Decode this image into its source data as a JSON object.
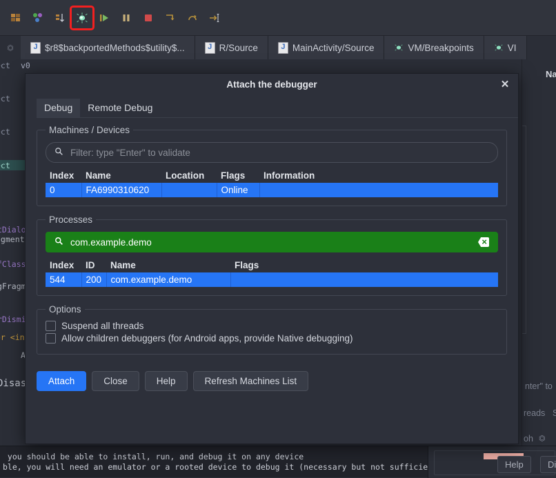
{
  "toolbar": {
    "icons": [
      {
        "name": "modules-icon",
        "highlighted": false
      },
      {
        "name": "processes-icon",
        "highlighted": false
      },
      {
        "name": "call-stack-icon",
        "highlighted": false
      },
      {
        "name": "attach-debugger-icon",
        "highlighted": true
      },
      {
        "name": "resume-icon",
        "highlighted": false
      },
      {
        "name": "pause-icon",
        "highlighted": false
      },
      {
        "name": "stop-icon",
        "highlighted": false
      },
      {
        "name": "step-over-icon",
        "highlighted": false
      },
      {
        "name": "step-out-icon",
        "highlighted": false
      },
      {
        "name": "run-to-cursor-icon",
        "highlighted": false
      }
    ]
  },
  "tabs": [
    {
      "label": "$r8$backportedMethods$utility$...",
      "icon": "java-file-icon",
      "active": true
    },
    {
      "label": "R/Source",
      "icon": "java-file-icon",
      "active": false
    },
    {
      "label": "MainActivity/Source",
      "icon": "java-file-icon",
      "active": false
    },
    {
      "label": "VM/Breakpoints",
      "icon": "bug-icon",
      "active": false
    },
    {
      "label": "VI",
      "icon": "bug-icon",
      "active": false
    }
  ],
  "editor": {
    "gutter_labels": [
      "ect",
      "ect",
      "ect",
      "ect"
    ],
    "top_value": "v0",
    "code_fragments": [
      "tDialog",
      "agment",
      "fClasse",
      "gFragme",
      "rDismis",
      "or <in",
      "A",
      "Disass"
    ]
  },
  "right_panel": {
    "header": "Na",
    "ghost_texts": [
      "nter\" to",
      "reads",
      "S",
      "oh"
    ],
    "ghost_buttons": [
      "lp",
      "Dis"
    ]
  },
  "console": {
    "lines": [
      " you should be able to install, run, and debug it on any device",
      "ble, you will need an emulator or a rooted device to debug it (necessary but not sufficient,"
    ]
  },
  "bottom_right": {
    "help_label": "Help",
    "dis_label": "Dis"
  },
  "dialog": {
    "title": "Attach the debugger",
    "close_icon": "close-icon",
    "tabs": [
      {
        "label": "Debug",
        "active": true
      },
      {
        "label": "Remote Debug",
        "active": false
      }
    ],
    "machines": {
      "legend": "Machines / Devices",
      "filter_placeholder": "Filter: type \"Enter\" to validate",
      "filter_value": "",
      "search_icon": "search-icon",
      "columns": [
        "Index",
        "Name",
        "Location",
        "Flags",
        "Information"
      ],
      "rows": [
        {
          "index": "0",
          "name": "FA6990310620",
          "location": "",
          "flags": "Online",
          "information": ""
        }
      ]
    },
    "processes": {
      "legend": "Processes",
      "filter_placeholder": "",
      "filter_value": "com.example.demo",
      "search_icon": "search-icon",
      "clear_icon": "clear-icon",
      "columns": [
        "Index",
        "ID",
        "Name",
        "Flags"
      ],
      "rows": [
        {
          "index": "544",
          "id": "200",
          "name": "com.example.demo",
          "flags": ""
        }
      ]
    },
    "options": {
      "legend": "Options",
      "items": [
        {
          "label": "Suspend all threads",
          "checked": false
        },
        {
          "label": "Allow children debuggers (for Android apps, provide Native debugging)",
          "checked": false
        }
      ]
    },
    "buttons": [
      {
        "label": "Attach",
        "primary": true
      },
      {
        "label": "Close",
        "primary": false
      },
      {
        "label": "Help",
        "primary": false
      },
      {
        "label": "Refresh Machines List",
        "primary": false
      }
    ]
  },
  "colors": {
    "accent_blue": "#2675f5",
    "search_green": "#1a8018",
    "highlight_red": "#f32020",
    "dialog_bg": "#2d303a",
    "ide_bg": "#2b2e37"
  }
}
